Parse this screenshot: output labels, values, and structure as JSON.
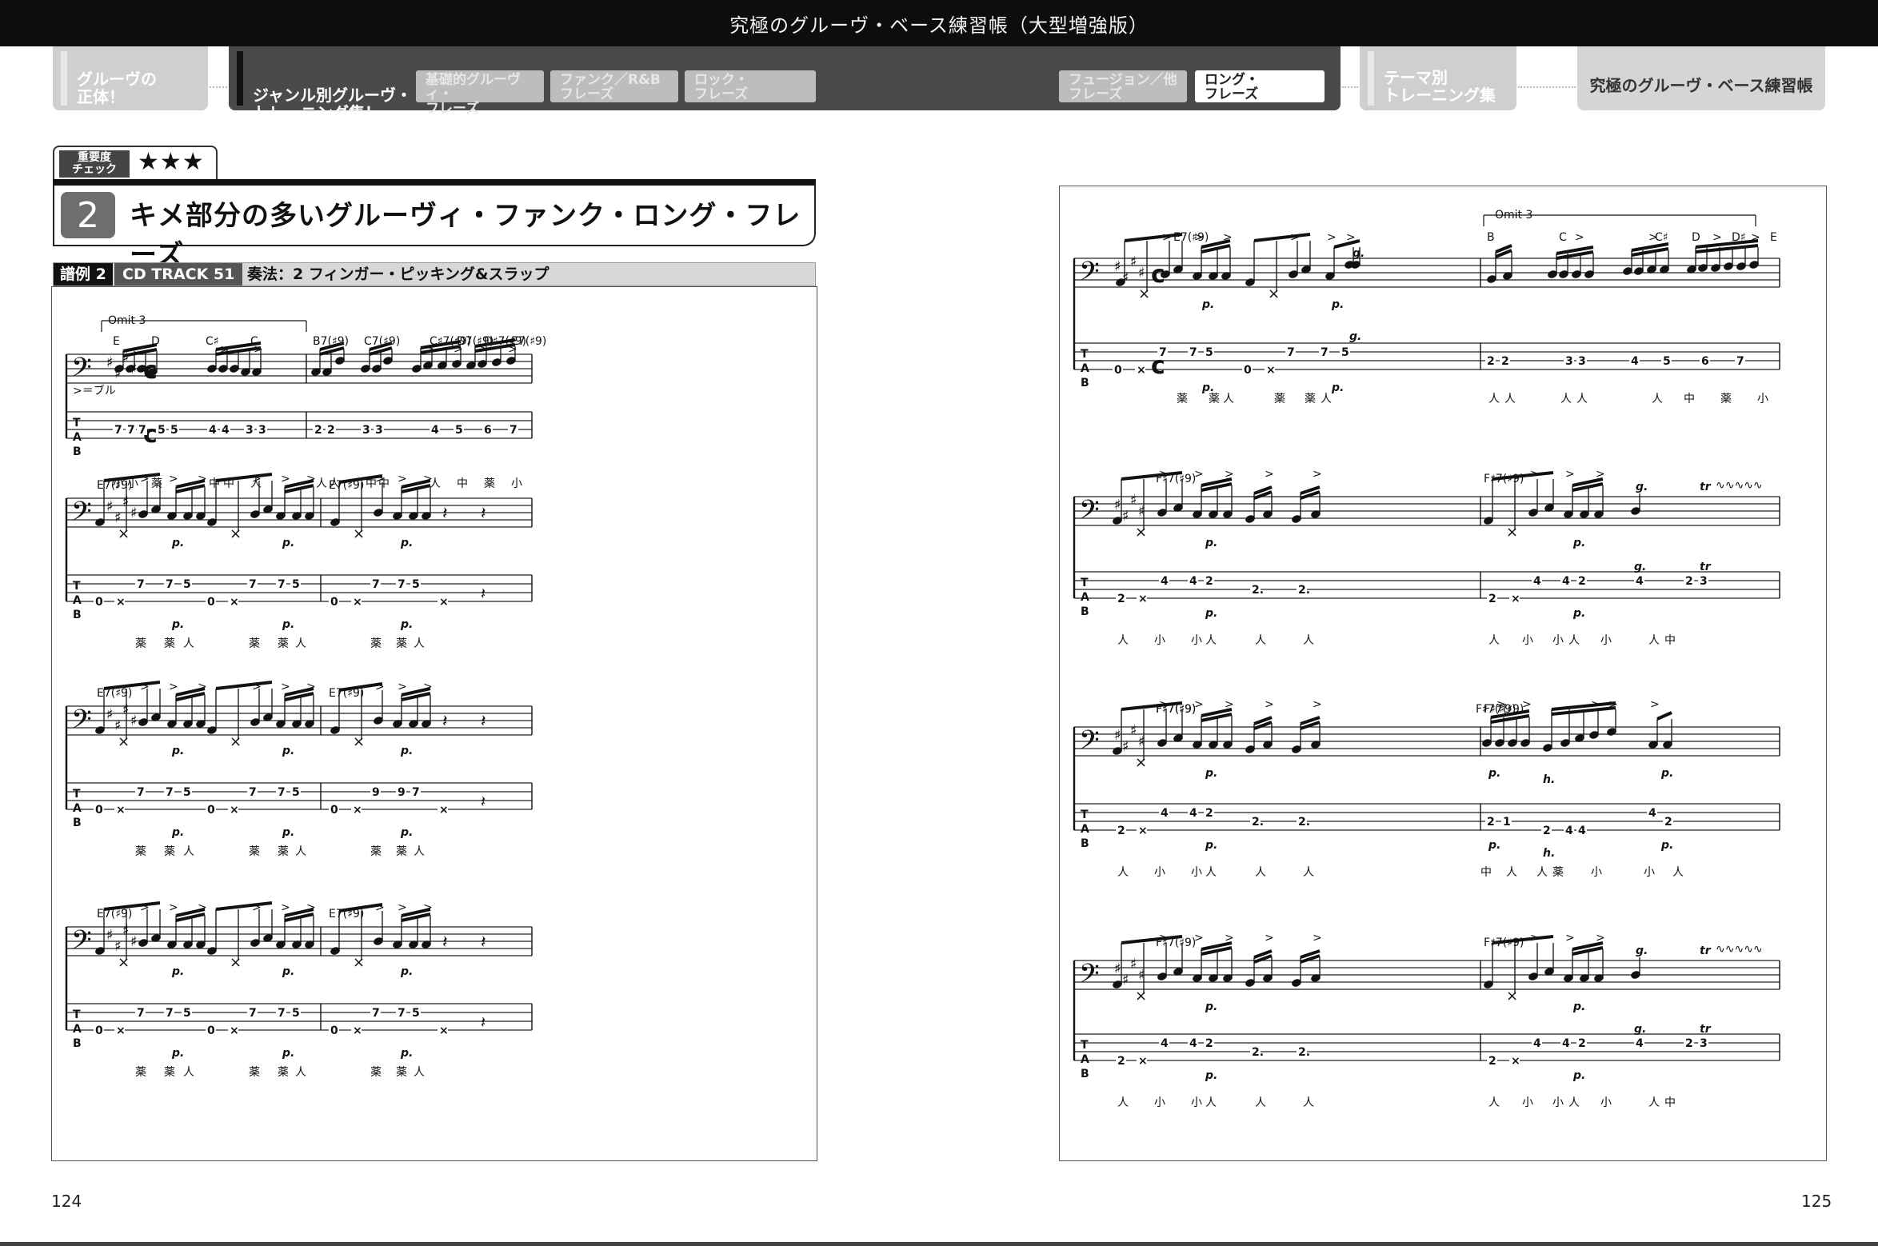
{
  "header": {
    "title": "究極のグルーヴ・ベース練習帳（大型増強版）"
  },
  "nav": {
    "left": "グルーヴの\n正体！",
    "active": "ジャンル別グルーヴ・\nトレーニング集！",
    "chips": [
      "基礎的グルーヴィ・\nフレーズ",
      "ファンク／R&B\nフレーズ",
      "ロック・\nフレーズ",
      "フュージョン／他\nフレーズ",
      "ロング・\nフレーズ"
    ],
    "theme": "テーマ別\nトレーニング集",
    "right": "究極のグルーヴ・ベース練習帳"
  },
  "importance": {
    "label": "重要度\nチェック",
    "stars": "★★★"
  },
  "section": {
    "number": "2",
    "title": "キメ部分の多いグルーヴィ・ファンク・ロング・フレーズ"
  },
  "example": {
    "label": "譜例 2",
    "track": "CD TRACK 51",
    "technique": "奏法：2 フィンガー・ピッキング&スラップ"
  },
  "music": {
    "omit3": "Omit 3",
    "bull": ">＝ブル",
    "chords_sys1": [
      "E",
      "D",
      "C♯",
      "C",
      "B7(♯9)",
      "C7(♯9)",
      "C♯7(♯9)",
      "D7(♯9)",
      "D♯7(♯9)",
      "E7(♯9)"
    ],
    "chords_right_sys1": [
      "E7(♯9)",
      "B",
      "C",
      "C♯",
      "D",
      "D♯",
      "E"
    ],
    "e7": "E7(♯9)",
    "fs7": "F♯7(♯9)",
    "tab_sys1": [
      "7",
      "7",
      "7",
      "5",
      "5",
      "4",
      "4",
      "3",
      "3",
      "2",
      "2",
      "3",
      "3",
      "4",
      "5",
      "6",
      "7"
    ],
    "tab_pair_a": [
      "0",
      "7",
      "7",
      "5",
      "0",
      "7",
      "7",
      "5"
    ],
    "tab_pair_b": [
      "0",
      "9",
      "9",
      "7"
    ],
    "tab_right1a": [
      "0",
      "7",
      "7",
      "5",
      "0",
      "7",
      "7",
      "5"
    ],
    "tab_right1b": [
      "2",
      "2",
      "3",
      "3",
      "4",
      "5",
      "6",
      "7"
    ],
    "tab_fs": [
      "2",
      "4",
      "4",
      "2",
      "2"
    ],
    "tab_fs_tr": [
      "2",
      "4",
      "4",
      "2",
      "4",
      "2",
      "3"
    ],
    "tab_fs_b": [
      "2",
      "1",
      "2",
      "4",
      "4",
      "4",
      "2"
    ],
    "finger_sys1": [
      "小",
      "小",
      "薬",
      "中",
      "中",
      "人",
      "人",
      "人",
      "中",
      "中",
      "人",
      "中",
      "薬",
      "小"
    ],
    "finger_e7": [
      "薬",
      "薬",
      "人",
      "薬",
      "薬",
      "人"
    ],
    "finger_e7b": [
      "薬",
      "薬",
      "人"
    ],
    "finger_r1a": [
      "薬",
      "薬",
      "人",
      "薬",
      "薬",
      "人"
    ],
    "finger_r1b": [
      "人",
      "人",
      "人",
      "人",
      "人",
      "中",
      "薬",
      "小"
    ],
    "finger_fs": [
      "人",
      "小",
      "小",
      "人",
      "人",
      "人"
    ],
    "finger_fs_b": [
      "人",
      "小",
      "小",
      "人",
      "小",
      "人",
      "中"
    ],
    "finger_fs_c": [
      "中",
      "人",
      "人",
      "薬",
      "小",
      "小",
      "人"
    ],
    "marks": {
      "p": "p.",
      "h": "h.",
      "g": "g.",
      "tr": "tr"
    }
  },
  "pages": {
    "left": "124",
    "right": "125"
  }
}
